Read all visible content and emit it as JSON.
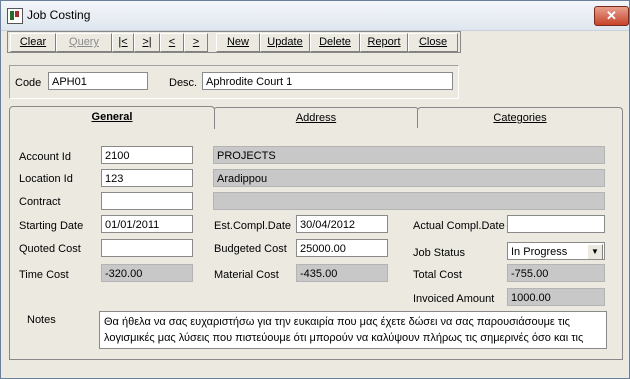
{
  "window": {
    "title": "Job Costing",
    "close_glyph": "✕"
  },
  "toolbar": {
    "clear": "Clear",
    "query": "Query",
    "first": "|<",
    "last": ">|",
    "prev": "<",
    "next": ">",
    "new": "New",
    "update": "Update",
    "delete": "Delete",
    "report": "Report",
    "close": "Close"
  },
  "header": {
    "code_label": "Code",
    "code_value": "APH01",
    "desc_label": "Desc.",
    "desc_value": "Aphrodite Court 1"
  },
  "tabs": {
    "general": "General",
    "address": "Address",
    "categories": "Categories"
  },
  "general": {
    "account_id_label": "Account Id",
    "account_id": "2100",
    "account_name": "PROJECTS",
    "location_id_label": "Location Id",
    "location_id": "123",
    "location_name": "Aradippou",
    "contract_label": "Contract",
    "contract": "",
    "contract_name": "",
    "starting_date_label": "Starting Date",
    "starting_date": "01/01/2011",
    "est_compl_label": "Est.Compl.Date",
    "est_compl_date": "30/04/2012",
    "actual_compl_label": "Actual Compl.Date",
    "actual_compl_date": "",
    "quoted_cost_label": "Quoted Cost",
    "quoted_cost": "",
    "budgeted_cost_label": "Budgeted Cost",
    "budgeted_cost": "25000.00",
    "job_status_label": "Job Status",
    "job_status": "In Progress",
    "time_cost_label": "Time Cost",
    "time_cost": "-320.00",
    "material_cost_label": "Material  Cost",
    "material_cost": "-435.00",
    "total_cost_label": "Total Cost",
    "total_cost": "-755.00",
    "invoiced_amount_label": "Invoiced Amount",
    "invoiced_amount": "1000.00",
    "notes_label": "Notes",
    "notes": "Θα ήθελα να σας ευχαριστήσω για την ευκαιρία που μας έχετε δώσει να σας παρουσιάσουμε τις λογισμικές μας λύσεις που πιστεύουμε ότι μπορούν να καλύψουν πλήρως τις σημερινές όσο και τις"
  }
}
